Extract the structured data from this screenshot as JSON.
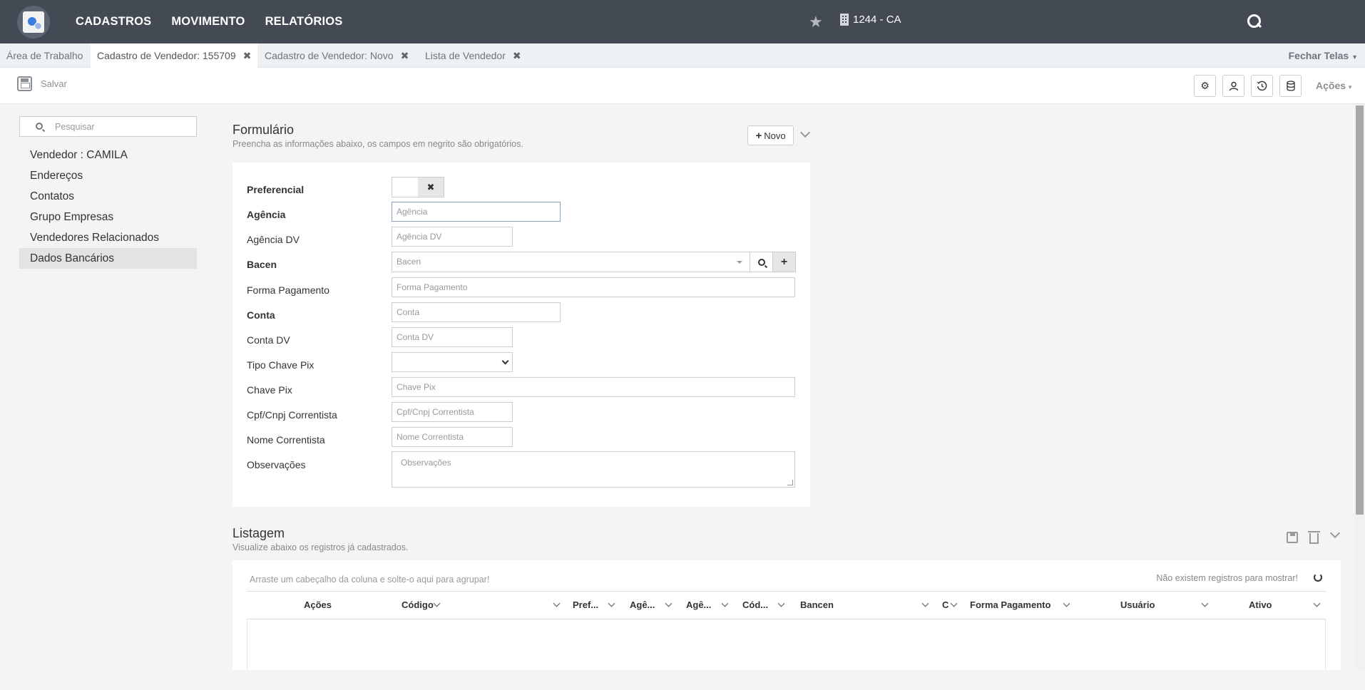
{
  "topbar": {
    "menu": [
      "CADASTROS",
      "MOVIMENTO",
      "RELATÓRIOS"
    ],
    "company": "1244 - CA"
  },
  "tabs": [
    {
      "label": "Área de Trabalho",
      "closable": false
    },
    {
      "label": "Cadastro de Vendedor: 155709",
      "closable": true
    },
    {
      "label": "Cadastro de Vendedor: Novo",
      "closable": true
    },
    {
      "label": "Lista de Vendedor",
      "closable": true
    }
  ],
  "tab_close_glyph": "✖",
  "fechar_telas": "Fechar Telas",
  "toolbar": {
    "save_label": "Salvar",
    "acoes_label": "Ações",
    "icons": [
      "gear-icon",
      "user-icon",
      "history-icon",
      "database-icon"
    ]
  },
  "sidebar": {
    "search_placeholder": "Pesquisar",
    "items": [
      "Vendedor : CAMILA",
      "Endereços",
      "Contatos",
      "Grupo Empresas",
      "Vendedores Relacionados",
      "Dados Bancários"
    ],
    "active_index": 5
  },
  "form": {
    "title": "Formulário",
    "subtitle": "Preencha as informações abaixo, os campos em negrito são obrigatórios.",
    "novo_label": "Novo",
    "labels": {
      "preferencial": "Preferencial",
      "agencia": "Agência",
      "agencia_dv": "Agência DV",
      "bacen": "Bacen",
      "forma_pagamento": "Forma Pagamento",
      "conta": "Conta",
      "conta_dv": "Conta DV",
      "tipo_chave_pix": "Tipo Chave Pix",
      "chave_pix": "Chave Pix",
      "cpf_cnpj": "Cpf/Cnpj Correntista",
      "nome_correntista": "Nome Correntista",
      "observacoes": "Observações"
    },
    "placeholders": {
      "agencia": "Agência",
      "agencia_dv": "Agência DV",
      "bacen": "Bacen",
      "forma_pagamento": "Forma Pagamento",
      "conta": "Conta",
      "conta_dv": "Conta DV",
      "chave_pix": "Chave Pix",
      "cpf_cnpj": "Cpf/Cnpj Correntista",
      "nome_correntista": "Nome Correntista",
      "observacoes": "Observações"
    },
    "toggle_glyph": "✖",
    "add_glyph": "+"
  },
  "listing": {
    "title": "Listagem",
    "subtitle": "Visualize abaixo os registros já cadastrados.",
    "drag_hint": "Arraste um cabeçalho da coluna e solte-o aqui para agrupar!",
    "no_records": "Não existem registros para mostrar!",
    "columns": [
      "Ações",
      "Código",
      "Pref...",
      "Agê...",
      "Agê...",
      "Cód...",
      "Bancen",
      "C",
      "Forma Pagamento",
      "Usuário",
      "Ativo"
    ]
  }
}
